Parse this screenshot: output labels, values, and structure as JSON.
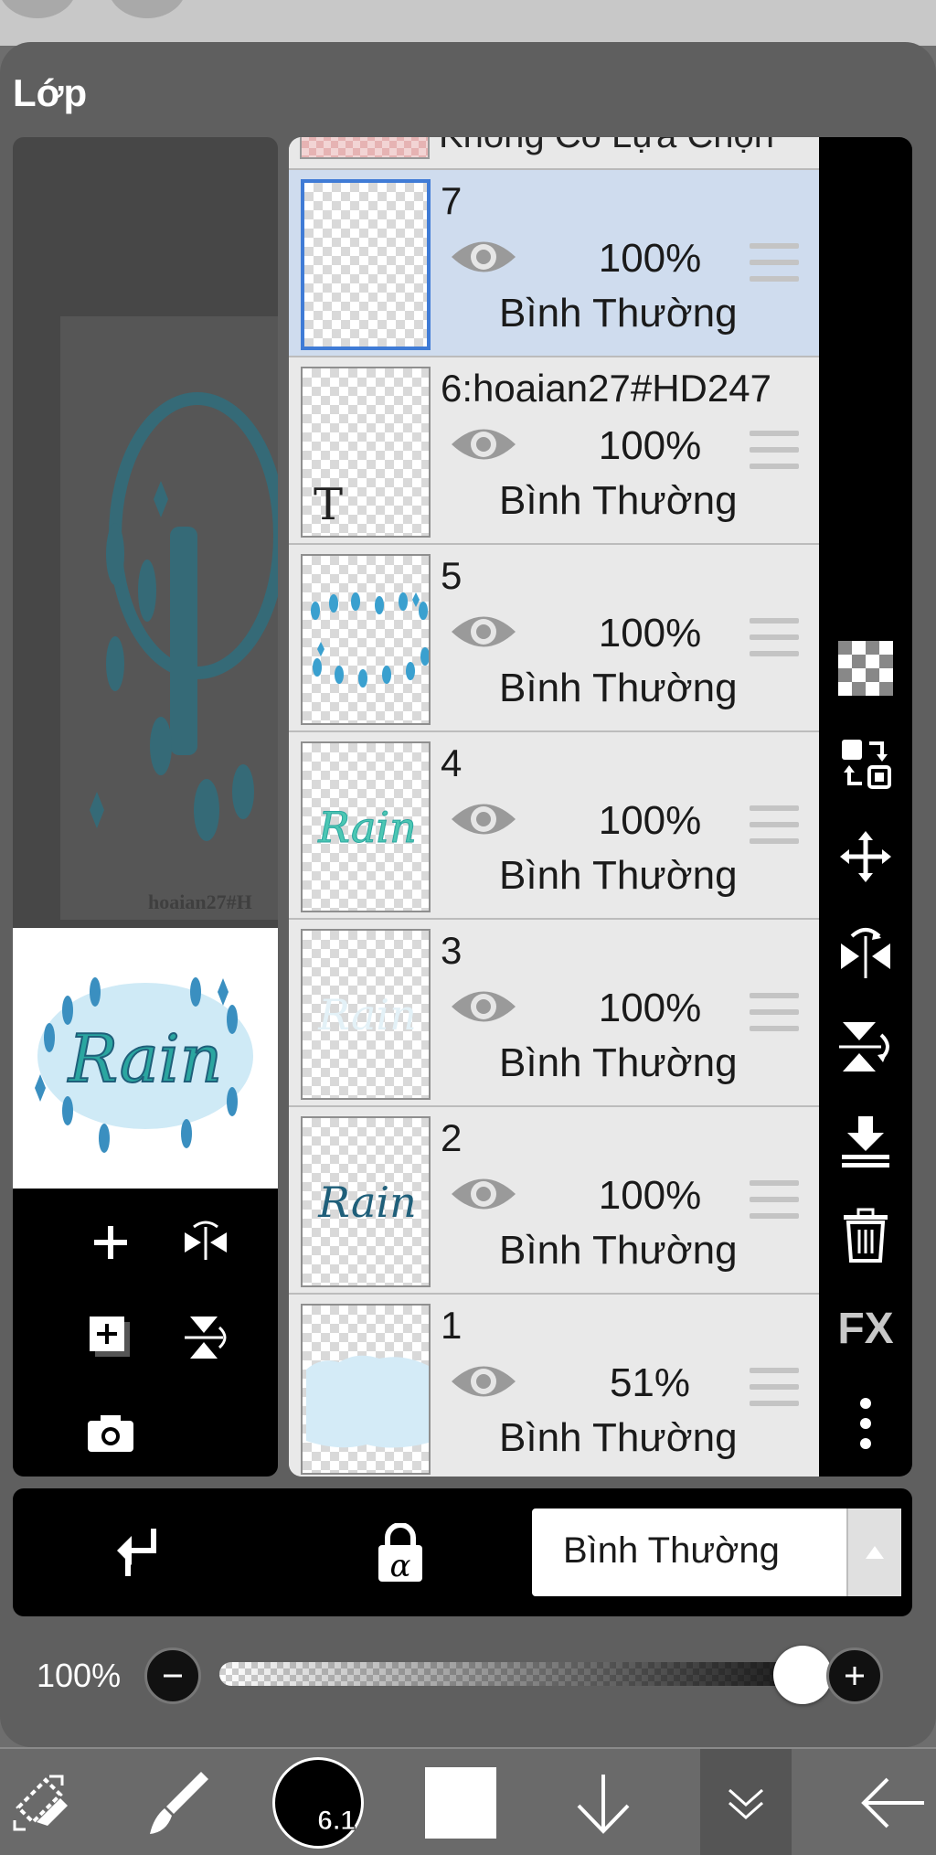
{
  "panel": {
    "title": "Lớp"
  },
  "layer_peek": {
    "label": "Không Có Lựa Chọn"
  },
  "layers": [
    {
      "name": "7",
      "opacity": "100%",
      "blend": "Bình Thường",
      "selected": true,
      "thumb": "empty"
    },
    {
      "name": "6:hoaian27#HD247",
      "opacity": "100%",
      "blend": "Bình Thường",
      "selected": false,
      "thumb": "text",
      "thumb_text": "T"
    },
    {
      "name": "5",
      "opacity": "100%",
      "blend": "Bình Thường",
      "selected": false,
      "thumb": "sparkles"
    },
    {
      "name": "4",
      "opacity": "100%",
      "blend": "Bình Thường",
      "selected": false,
      "thumb": "rain-teal",
      "thumb_text": "Rain"
    },
    {
      "name": "3",
      "opacity": "100%",
      "blend": "Bình Thường",
      "selected": false,
      "thumb": "rain-faint",
      "thumb_text": "Rain"
    },
    {
      "name": "2",
      "opacity": "100%",
      "blend": "Bình Thường",
      "selected": false,
      "thumb": "rain-dark",
      "thumb_text": "Rain"
    },
    {
      "name": "1",
      "opacity": "51%",
      "blend": "Bình Thường",
      "selected": false,
      "thumb": "cloud"
    }
  ],
  "preview": {
    "thumb_text": "Rain",
    "watermark": "hoaian27#H"
  },
  "right_tools": [
    "transparency-icon",
    "swap-layers-icon",
    "move-icon",
    "flip-horizontal-icon",
    "flip-vertical-icon",
    "merge-down-icon",
    "trash-icon",
    "fx-icon",
    "more-icon"
  ],
  "fx_label": "FX",
  "blend_bar": {
    "mode": "Bình Thường",
    "alpha_label": "α"
  },
  "opacity_slider": {
    "value_label": "100%",
    "value": 1.0
  },
  "bottom_bar": {
    "brush_size": "6.1",
    "color": "#ffffff"
  },
  "colors": {
    "selected_layer": "#cfdcee",
    "selected_border": "#3f7bd6",
    "rain_teal": "#2aa6a0",
    "rain_blue": "#1f5f7a"
  }
}
